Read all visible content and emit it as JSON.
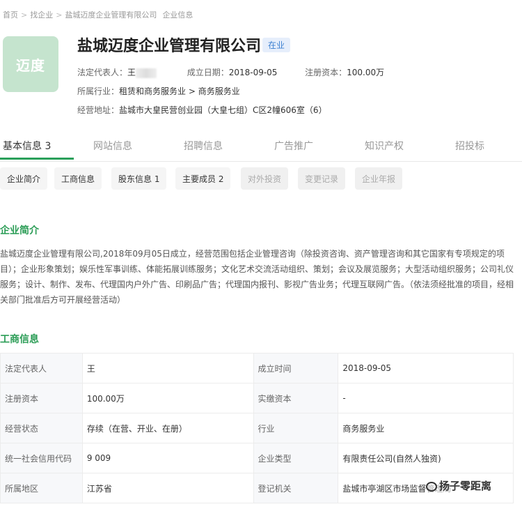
{
  "breadcrumb": [
    "首页",
    "找企业",
    "盐城迈度企业管理有限公司",
    "企业信息"
  ],
  "company": {
    "logo_text": "迈度",
    "name": "盐城迈度企业管理有限公司",
    "status": "在业",
    "legal_rep_label": "法定代表人：",
    "legal_rep_value": "王",
    "founded_label": "成立日期：",
    "founded_value": "2018-09-05",
    "capital_label": "注册资本：",
    "capital_value": "100.00万",
    "industry_label": "所属行业：",
    "industry_value": "租赁和商务服务业 > 商务服务业",
    "address_label": "经营地址：",
    "address_value": "盐城市大皇民营创业园（大皇七组）C区2幢606室（6）"
  },
  "main_tabs": [
    "基本信息 3",
    "网站信息",
    "招聘信息",
    "广告推广",
    "知识产权",
    "招投标"
  ],
  "sub_tabs": [
    {
      "label": "企业简介",
      "disabled": false
    },
    {
      "label": "工商信息",
      "disabled": false
    },
    {
      "label": "股东信息 1",
      "disabled": false
    },
    {
      "label": "主要成员 2",
      "disabled": false
    },
    {
      "label": "对外投资",
      "disabled": true
    },
    {
      "label": "变更记录",
      "disabled": true
    },
    {
      "label": "企业年报",
      "disabled": true
    }
  ],
  "intro": {
    "title": "企业简介",
    "text": "盐城迈度企业管理有限公司,2018年09月05日成立，经营范围包括企业管理咨询（除投资咨询、资产管理咨询和其它国家有专项规定的项目）；企业形象策划；娱乐性军事训练、体能拓展训练服务；文化艺术交流活动组织、策划；会议及展览服务；大型活动组织服务；公司礼仪服务；设计、制作、发布、代理国内户外广告、印刷品广告；代理国内报刊、影视广告业务；代理互联网广告。（依法须经批准的项目，经相关部门批准后方可开展经营活动）"
  },
  "business": {
    "title": "工商信息",
    "rows": [
      [
        "法定代表人",
        "王",
        "成立时间",
        "2018-09-05"
      ],
      [
        "注册资本",
        "100.00万",
        "实缴资本",
        "-"
      ],
      [
        "经营状态",
        "存续（在营、开业、在册）",
        "行业",
        "商务服务业"
      ],
      [
        "统一社会信用代码",
        "9            009",
        "企业类型",
        "有限责任公司(自然人独资)"
      ],
      [
        "所属地区",
        "江苏省",
        "登记机关",
        "盐城市亭湖区市场监督管理局"
      ]
    ]
  },
  "watermark": "扬子零距离"
}
